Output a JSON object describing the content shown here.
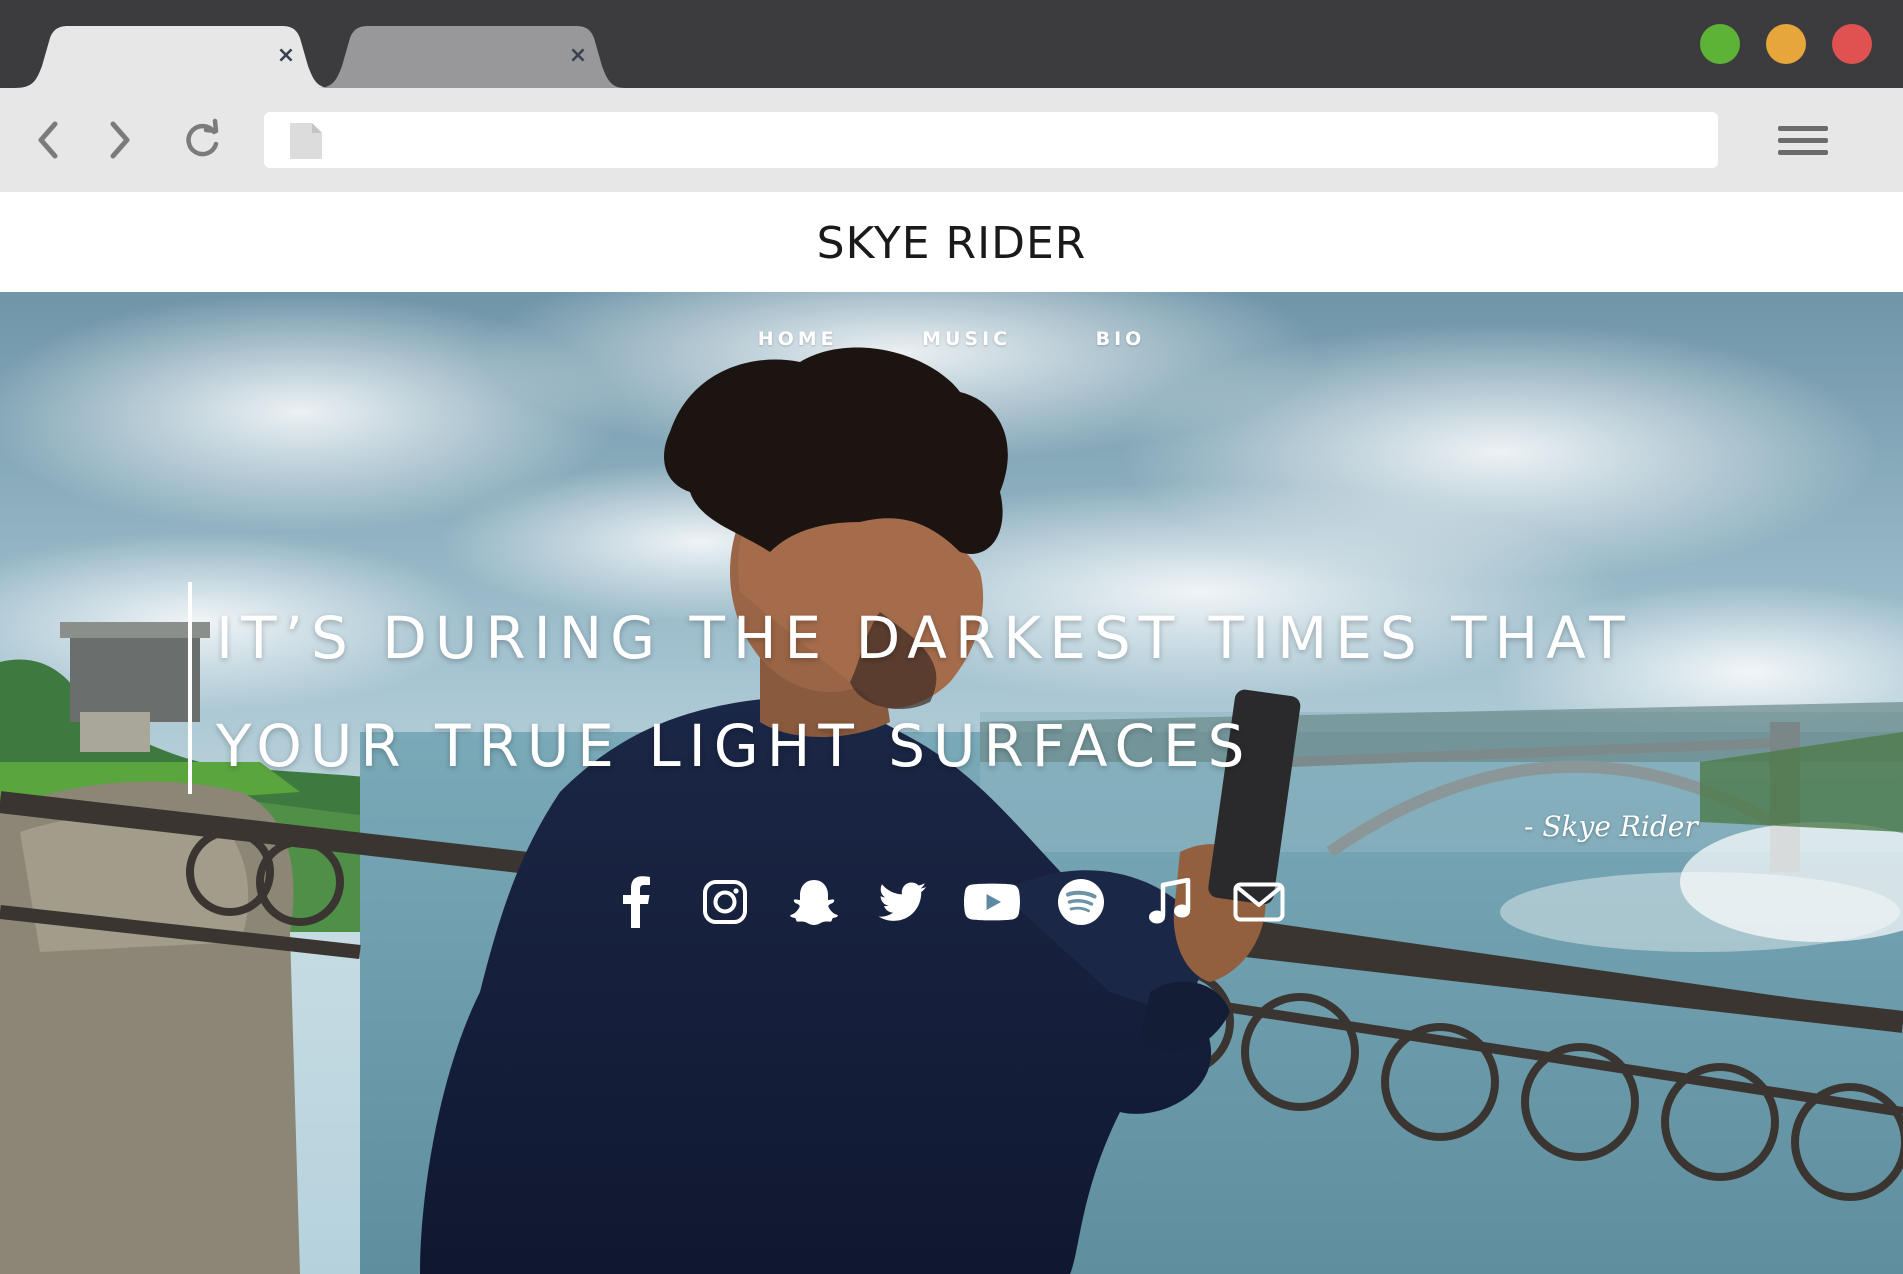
{
  "browser": {
    "tabs": [
      {
        "label": "",
        "close": "×",
        "active": true
      },
      {
        "label": "",
        "close": "×",
        "active": false
      }
    ],
    "window_controls": {
      "green": "#5cb336",
      "yellow": "#e7a63c",
      "red": "#e05252"
    },
    "address": {
      "value": "",
      "placeholder": ""
    },
    "icons": {
      "back": "chevron-left-icon",
      "forward": "chevron-right-icon",
      "reload": "reload-icon",
      "page": "page-icon",
      "menu": "hamburger-menu-icon"
    }
  },
  "site": {
    "title": "SKYE RIDER",
    "nav": [
      {
        "label": "HOME"
      },
      {
        "label": "MUSIC"
      },
      {
        "label": "BIO"
      }
    ],
    "quote": {
      "line1": "IT’S DURING THE DARKEST TIMES THAT",
      "line2": "YOUR TRUE LIGHT SURFACES",
      "attribution": "- Skye Rider"
    },
    "socials": [
      {
        "name": "facebook-icon"
      },
      {
        "name": "instagram-icon"
      },
      {
        "name": "snapchat-icon"
      },
      {
        "name": "twitter-icon"
      },
      {
        "name": "youtube-icon"
      },
      {
        "name": "spotify-icon"
      },
      {
        "name": "music-note-icon"
      },
      {
        "name": "email-icon"
      }
    ]
  }
}
